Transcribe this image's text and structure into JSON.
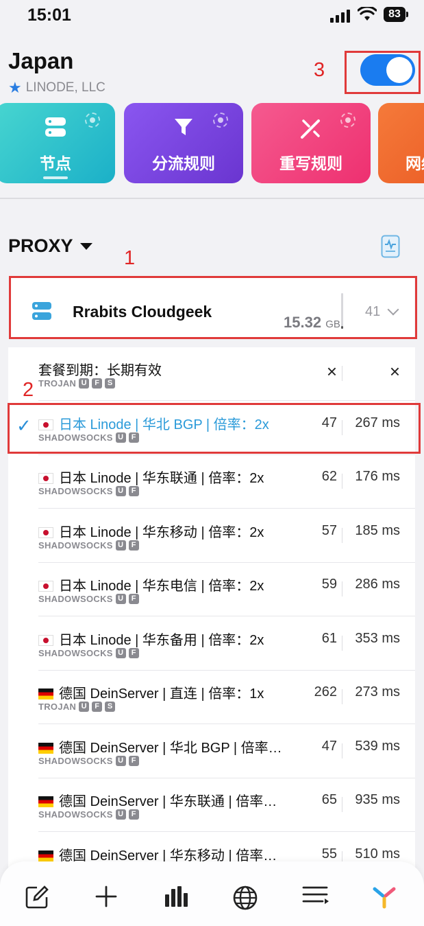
{
  "status_bar": {
    "time": "15:01",
    "battery": "83"
  },
  "header": {
    "title": "Japan",
    "subtitle": "LINODE, LLC"
  },
  "toggle": {
    "on": true
  },
  "annotations": {
    "a1": "1",
    "a2": "2",
    "a3": "3"
  },
  "tiles": [
    {
      "label": "节点",
      "icon": "server-icon",
      "color": "#2ec4c8"
    },
    {
      "label": "分流规则",
      "icon": "filter-icon",
      "color": "#7a45e0"
    },
    {
      "label": "重写规则",
      "icon": "wand-icon",
      "color": "#f0477a"
    },
    {
      "label": "网络",
      "icon": "network-icon",
      "color": "#f06a2a"
    }
  ],
  "proxy": {
    "title": "PROXY"
  },
  "group": {
    "name": "Rrabits Cloudgeek",
    "usage_value": "15.32",
    "usage_unit": "GB",
    "count": "41",
    "usage_fill": 0.08
  },
  "rows": [
    {
      "flag": "",
      "name": "套餐到期：长期有效",
      "protocol": "TROJAN",
      "badges": [
        "U",
        "F",
        "S"
      ],
      "num": "×",
      "ms": "×",
      "selected": false
    },
    {
      "flag": "jp",
      "name": "日本 Linode | 华北 BGP | 倍率：2x",
      "protocol": "SHADOWSOCKS",
      "badges": [
        "U",
        "F"
      ],
      "num": "47",
      "ms": "267 ms",
      "selected": true
    },
    {
      "flag": "jp",
      "name": "日本 Linode | 华东联通 | 倍率：2x",
      "protocol": "SHADOWSOCKS",
      "badges": [
        "U",
        "F"
      ],
      "num": "62",
      "ms": "176 ms",
      "selected": false
    },
    {
      "flag": "jp",
      "name": "日本 Linode | 华东移动 | 倍率：2x",
      "protocol": "SHADOWSOCKS",
      "badges": [
        "U",
        "F"
      ],
      "num": "57",
      "ms": "185 ms",
      "selected": false
    },
    {
      "flag": "jp",
      "name": "日本 Linode | 华东电信 | 倍率：2x",
      "protocol": "SHADOWSOCKS",
      "badges": [
        "U",
        "F"
      ],
      "num": "59",
      "ms": "286 ms",
      "selected": false
    },
    {
      "flag": "jp",
      "name": "日本 Linode | 华东备用 | 倍率：2x",
      "protocol": "SHADOWSOCKS",
      "badges": [
        "U",
        "F"
      ],
      "num": "61",
      "ms": "353 ms",
      "selected": false
    },
    {
      "flag": "de",
      "name": "德国 DeinServer | 直连 | 倍率：1x",
      "protocol": "TROJAN",
      "badges": [
        "U",
        "F",
        "S"
      ],
      "num": "262",
      "ms": "273 ms",
      "selected": false
    },
    {
      "flag": "de",
      "name": "德国 DeinServer | 华北 BGP | 倍率…",
      "protocol": "SHADOWSOCKS",
      "badges": [
        "U",
        "F"
      ],
      "num": "47",
      "ms": "539 ms",
      "selected": false
    },
    {
      "flag": "de",
      "name": "德国 DeinServer | 华东联通 | 倍率…",
      "protocol": "SHADOWSOCKS",
      "badges": [
        "U",
        "F"
      ],
      "num": "65",
      "ms": "935 ms",
      "selected": false
    },
    {
      "flag": "de",
      "name": "德国 DeinServer | 华东移动 | 倍率…",
      "protocol": "",
      "badges": [],
      "num": "55",
      "ms": "510 ms",
      "selected": false
    }
  ],
  "bottom_nav": [
    "edit-icon",
    "add-icon",
    "stats-icon",
    "globe-icon",
    "list-icon",
    "app-logo-icon"
  ]
}
